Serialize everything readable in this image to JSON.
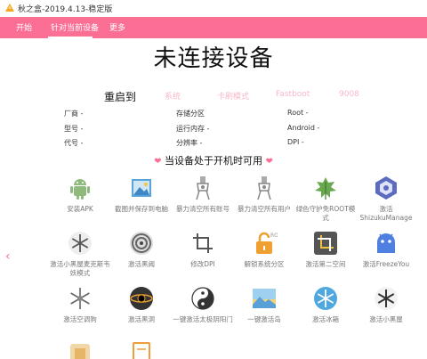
{
  "window": {
    "title": "秋之盒-2019.4.13-稳定版"
  },
  "nav": {
    "tabs": [
      "开始",
      "针对当前设备",
      "更多"
    ]
  },
  "main": {
    "status_title": "未连接设备",
    "reboot": {
      "label": "重启到",
      "options": [
        "系统",
        "卡刷模式",
        "Fastboot",
        "9008"
      ]
    },
    "info": {
      "col1": [
        "厂商 -",
        "型号 -",
        "代号 -"
      ],
      "col2": [
        "存储分区",
        "运行内存 -",
        "分辨率 -"
      ],
      "col3": [
        "Root -",
        "Android -",
        "DPI -"
      ]
    },
    "section_title": "当设备处于开机时可用",
    "tools": [
      {
        "label": "安装APK",
        "icon": "android-icon"
      },
      {
        "label": "截图并保存到电脑",
        "icon": "image-icon"
      },
      {
        "label": "暴力清空所有账号",
        "icon": "clamp-icon"
      },
      {
        "label": "暴力清空所有用户",
        "icon": "clamp-icon"
      },
      {
        "label": "绿色守护免ROOT模式",
        "icon": "leaf-icon"
      },
      {
        "label": "激活ShizukuManage",
        "icon": "hexagon-icon"
      },
      {
        "label": "激活小黑屋麦克斯韦妖模式",
        "icon": "snowflake-icon"
      },
      {
        "label": "激活黑阈",
        "icon": "swirl-icon"
      },
      {
        "label": "修改DPI",
        "icon": "crop-icon"
      },
      {
        "label": "解锁系统分区",
        "icon": "unlock-icon"
      },
      {
        "label": "激活第二空间",
        "icon": "crop-dark-icon"
      },
      {
        "label": "激活FreezeYou",
        "icon": "android-blue-icon"
      },
      {
        "label": "激活空调狗",
        "icon": "snowflake-icon"
      },
      {
        "label": "激活黑洞",
        "icon": "blackhole-icon"
      },
      {
        "label": "一键激活太极阴阳门",
        "icon": "yinyang-icon"
      },
      {
        "label": "一键激活岛",
        "icon": "island-icon"
      },
      {
        "label": "激活冰箱",
        "icon": "snowflake-blue-icon"
      },
      {
        "label": "激活小黑屋",
        "icon": "snowflake-dark-icon"
      }
    ],
    "colors": {
      "accent": "#fb6f95"
    }
  }
}
